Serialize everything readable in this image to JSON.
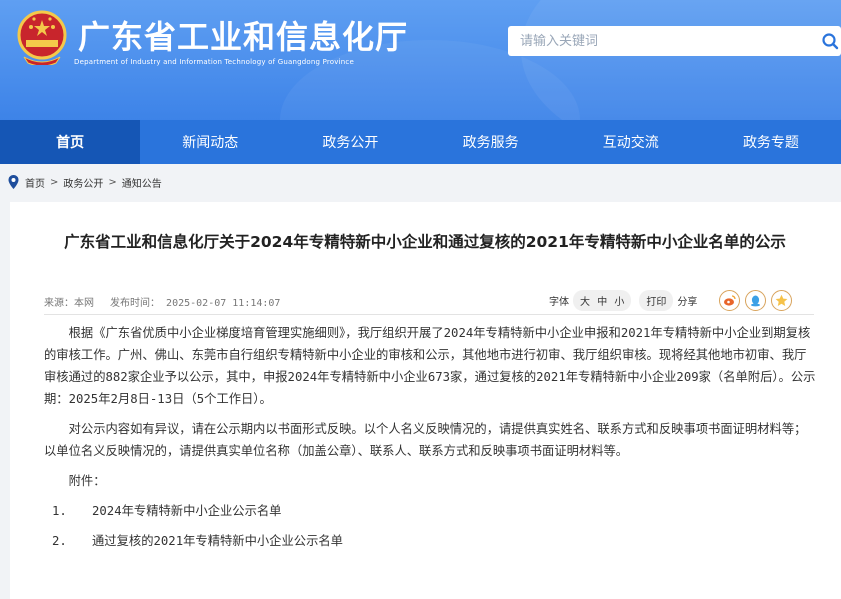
{
  "header": {
    "title": "广东省工业和信息化厅",
    "subtitle": "Department of Industry and Information Technology of Guangdong Province",
    "search_placeholder": "请输入关键词",
    "emblem_icon": "national-emblem-icon",
    "search_icon": "search-icon"
  },
  "nav": {
    "items": [
      "首页",
      "新闻动态",
      "政务公开",
      "政务服务",
      "互动交流",
      "政务专题"
    ],
    "active_index": 0
  },
  "breadcrumb": {
    "icon": "location-pin-icon",
    "items": [
      "首页",
      "政务公开",
      "通知公告"
    ],
    "separator": ">"
  },
  "article": {
    "title": "广东省工业和信息化厅关于2024年专精特新中小企业和通过复核的2021年专精特新中小企业名单的公示",
    "source": "来源：本网",
    "published": "发布时间： 2025-02-07 11:14:07",
    "font_label": "字体",
    "font_sizes": [
      "大",
      "中",
      "小"
    ],
    "print_label": "打印",
    "share_label": "分享",
    "share_icons": [
      "weibo-icon",
      "qq-icon",
      "qzone-icon"
    ],
    "paragraphs": [
      "根据《广东省优质中小企业梯度培育管理实施细则》，我厅组织开展了2024年专精特新中小企业申报和2021年专精特新中小企业到期复核的审核工作。广州、佛山、东莞市自行组织专精特新中小企业的审核和公示，其他地市进行初审、我厅组织审核。现将经其他地市初审、我厅审核通过的882家企业予以公示，其中，申报2024年专精特新中小企业673家，通过复核的2021年专精特新中小企业209家（名单附后）。公示期：2025年2月8日-13日（5个工作日）。",
      "对公示内容如有异议，请在公示期内以书面形式反映。以个人名义反映情况的，请提供真实姓名、联系方式和反映事项书面证明材料等；以单位名义反映情况的，请提供真实单位名称（加盖公章）、联系人、联系方式和反映事项书面证明材料等。",
      "附件："
    ],
    "attachments": [
      {
        "num": "1.",
        "name": "2024年专精特新中小企业公示名单"
      },
      {
        "num": "2.",
        "name": "通过复核的2021年专精特新中小企业公示名单"
      }
    ]
  },
  "colors": {
    "header_blue": "#4a8ef0",
    "nav_blue": "#2a74dc",
    "nav_active": "#1556b5"
  }
}
